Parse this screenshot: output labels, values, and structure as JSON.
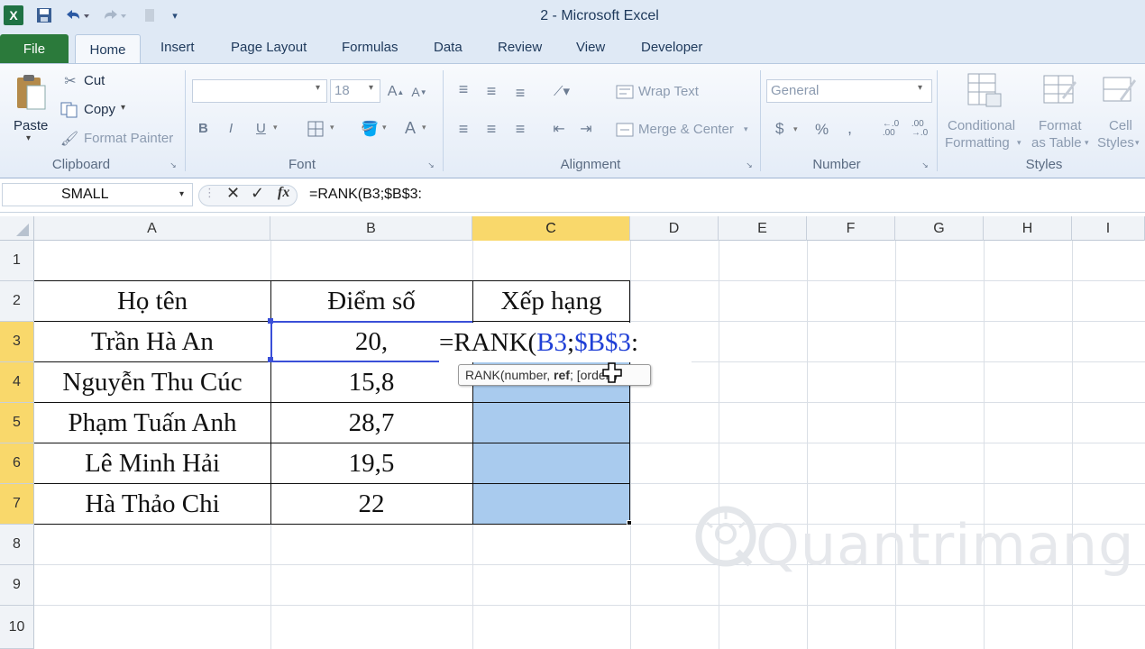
{
  "window": {
    "title": "2 - Microsoft Excel"
  },
  "quick_access": {
    "excel_icon": "excel-logo-icon",
    "save_icon": "save-icon",
    "undo_icon": "undo-icon",
    "redo_icon": "redo-icon",
    "customize_icon": "customize-icon"
  },
  "tabs": {
    "file": "File",
    "items": [
      "Home",
      "Insert",
      "Page Layout",
      "Formulas",
      "Data",
      "Review",
      "View",
      "Developer"
    ]
  },
  "ribbon": {
    "clipboard": {
      "group": "Clipboard",
      "paste": "Paste",
      "cut": "Cut",
      "copy": "Copy",
      "format_painter": "Format Painter"
    },
    "font": {
      "group": "Font",
      "size": "18",
      "bold": "B",
      "italic": "I",
      "underline": "U"
    },
    "alignment": {
      "group": "Alignment",
      "wrap": "Wrap Text",
      "merge": "Merge & Center"
    },
    "number": {
      "group": "Number",
      "format": "General",
      "currency": "$",
      "percent": "%",
      "comma": ","
    },
    "styles": {
      "group": "Styles",
      "conditional": [
        "Conditional",
        "Formatting"
      ],
      "format_table": [
        "Format",
        "as Table"
      ],
      "cell_styles": [
        "Cell",
        "Styles"
      ]
    }
  },
  "formula_bar": {
    "name_box": "SMALL",
    "fx": "fx",
    "formula": "=RANK(B3;$B$3:"
  },
  "columns": [
    "A",
    "B",
    "C",
    "D",
    "E",
    "F",
    "G",
    "H",
    "I"
  ],
  "selected_column": "C",
  "rows": [
    "1",
    "2",
    "3",
    "4",
    "5",
    "6",
    "7",
    "8",
    "9",
    "10"
  ],
  "selected_rows": [
    "3",
    "4",
    "5",
    "6",
    "7"
  ],
  "table": {
    "headers": [
      "Họ tên",
      "Điểm số",
      "Xếp hạng"
    ],
    "names": [
      "Trần Hà An",
      "Nguyễn Thu Cúc",
      "Phạm Tuấn Anh",
      "Lê Minh Hải",
      "Hà Thảo Chi"
    ],
    "scores": [
      "20,",
      "15,8",
      "28,7",
      "19,5",
      "22"
    ]
  },
  "editing": {
    "prefix": "=RANK(",
    "ref1": "B3",
    "semi": ";",
    "ref2": "$B$3",
    "suffix": ":",
    "colors": {
      "ref1": "#1f3fd6",
      "ref2": "#1f3fd6",
      "text": "#111111"
    }
  },
  "tooltip": {
    "func": "RANK(number, ",
    "bold_arg": "ref",
    "rest": "; [order])"
  },
  "watermark": "Quantrimang"
}
